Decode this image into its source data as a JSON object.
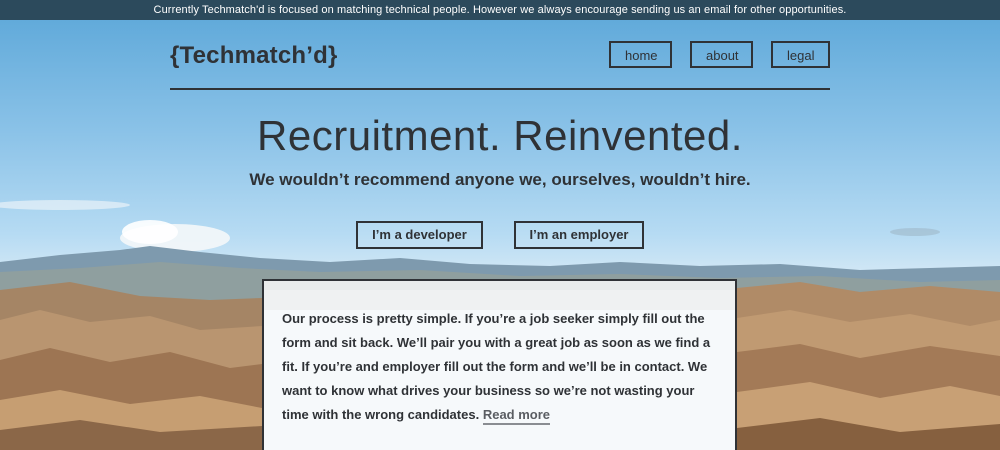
{
  "notice": {
    "text_before": "Currently Techmatch'd is focused on matching technical people. However we always encourage sending us an ",
    "email_link": "email",
    "text_after": " for other opportunities."
  },
  "header": {
    "logo": "{Techmatch’d}",
    "nav": [
      {
        "label": "home"
      },
      {
        "label": "about"
      },
      {
        "label": "legal"
      }
    ]
  },
  "hero": {
    "title": "Recruitment. Reinvented.",
    "subtitle": "We wouldn’t recommend anyone we, ourselves, wouldn’t hire.",
    "buttons": [
      {
        "label": "I’m a developer"
      },
      {
        "label": "I’m an employer"
      }
    ]
  },
  "content": {
    "body": "Our process is pretty simple. If you’re a job seeker simply fill out the form and sit back. We’ll pair you with a great job as soon as we find a fit. If you’re and employer fill out the form and we’ll be in contact. We want to know what drives your business so we’re not wasting your time with the wrong candidates.",
    "read_more": "Read more"
  },
  "colors": {
    "notice_bg": "#2c4a5c",
    "text": "#2f3236",
    "sky": "#8cc3e8"
  }
}
